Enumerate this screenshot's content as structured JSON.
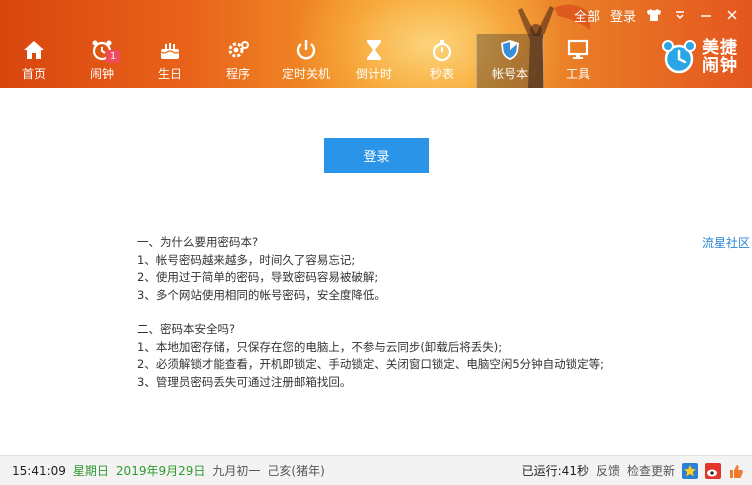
{
  "topbar": {
    "all_label": "全部",
    "login_label": "登录",
    "icons": [
      "shirt-icon",
      "dropdown-icon",
      "minimize-icon",
      "close-icon"
    ]
  },
  "nav": {
    "items": [
      {
        "label": "首页",
        "icon": "home-icon"
      },
      {
        "label": "闹钟",
        "icon": "alarm-icon",
        "badge": "1"
      },
      {
        "label": "生日",
        "icon": "cake-icon"
      },
      {
        "label": "程序",
        "icon": "gear-icon"
      },
      {
        "label": "定时关机",
        "icon": "power-icon"
      },
      {
        "label": "倒计时",
        "icon": "hourglass-icon"
      },
      {
        "label": "秒表",
        "icon": "stopwatch-icon"
      },
      {
        "label": "帐号本",
        "icon": "shield-icon",
        "active": true
      },
      {
        "label": "工具",
        "icon": "monitor-icon"
      }
    ]
  },
  "brand": {
    "line1": "美捷",
    "line2": "闹钟"
  },
  "main": {
    "login_button": "登录",
    "side_link": "流星社区",
    "section1": {
      "heading": "一、为什么要用密码本?",
      "lines": [
        "1、帐号密码越来越多，时间久了容易忘记;",
        "2、使用过于简单的密码，导致密码容易被破解;",
        "3、多个网站使用相同的帐号密码，安全度降低。"
      ]
    },
    "section2": {
      "heading": "二、密码本安全吗?",
      "lines": [
        "1、本地加密存储，只保存在您的电脑上，不参与云同步(卸载后将丢失);",
        "2、必须解锁才能查看，开机即锁定、手动锁定、关闭窗口锁定、电脑空闲5分钟自动锁定等;",
        "3、管理员密码丢失可通过注册邮箱找回。"
      ]
    }
  },
  "status": {
    "time": "15:41:09",
    "weekday": "星期日",
    "date": "2019年9月29日",
    "lunar": "九月初一",
    "ganzhi": "己亥(猪年)",
    "uptime": "已运行:41秒",
    "feedback": "反馈",
    "check_update": "检查更新"
  },
  "colors": {
    "header_orange": "#e9621a",
    "login_blue": "#2a94e8",
    "link_blue": "#2b86d6",
    "status_green": "#2e9a2e"
  }
}
